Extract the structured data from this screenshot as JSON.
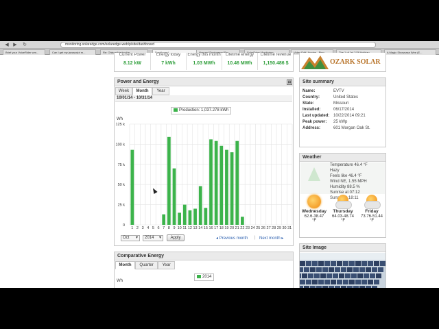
{
  "browser": {
    "url": "monitoring.solaredge.com/solaredge-web/p/site/dashboard",
    "tabs": [
      "Brief your VoiceRider wm...",
      "Can I get my javascript m...",
      "Re: Ohlson/Harbuckie...",
      "Dashboard",
      "Harvard Engineered Pro...",
      "SolarEdge Monitoring",
      "Video Edit Utopian - Bing",
      "The 1 of 1st 2/28 Holiday",
      "A Magic Showcase Wee (E..."
    ]
  },
  "stats": [
    {
      "label": "Current Power",
      "value": "8.12 kW"
    },
    {
      "label": "Energy today",
      "value": "7 kWh"
    },
    {
      "label": "Energy this month",
      "value": "1.03 MWh"
    },
    {
      "label": "Lifetime energy",
      "value": "10.46 MWh"
    },
    {
      "label": "Lifetime revenue",
      "value": "1,150.486 $"
    }
  ],
  "logo_text": "OZARK SOLAR",
  "power_energy": {
    "title": "Power and Energy",
    "tabs": [
      "Week",
      "Month",
      "Year"
    ],
    "selected_tab": "Month",
    "date_range": "10/01/14 - 10/31/14",
    "month_value": "Oct",
    "year_value": "2014",
    "apply_label": "Apply",
    "prev_label": "Previous month",
    "next_label": "Next month",
    "separator": "|",
    "prev_arrow": "◂",
    "next_arrow": "▸"
  },
  "chart_data": {
    "type": "bar",
    "ylabel": "Wh",
    "y_ticks": [
      "0",
      "25 k",
      "50 k",
      "75 k",
      "100 k",
      "125 k"
    ],
    "ylim": [
      0,
      125000
    ],
    "categories": [
      "1",
      "2",
      "3",
      "4",
      "5",
      "6",
      "7",
      "8",
      "9",
      "10",
      "11",
      "12",
      "13",
      "14",
      "15",
      "16",
      "17",
      "18",
      "19",
      "20",
      "21",
      "22",
      "23",
      "24",
      "25",
      "26",
      "27",
      "28",
      "29",
      "30",
      "31"
    ],
    "series": [
      {
        "name": "Production: 1,037.278 kWh",
        "color": "#3cb34b",
        "values": [
          93000,
          0,
          0,
          0,
          0,
          0,
          13000,
          109000,
          70000,
          15000,
          25000,
          18000,
          20000,
          48000,
          21000,
          106000,
          104000,
          98000,
          93000,
          90000,
          104000,
          10000,
          0,
          0,
          0,
          0,
          0,
          0,
          0,
          0,
          0
        ]
      }
    ],
    "grid": true,
    "legend": "top-center"
  },
  "site_summary": {
    "title": "Site summary",
    "rows": [
      {
        "label": "Name:",
        "value": "EVTV"
      },
      {
        "label": "Country:",
        "value": "United States"
      },
      {
        "label": "State:",
        "value": "Missouri"
      },
      {
        "label": "Installed:",
        "value": "06/17/2014"
      },
      {
        "label": "Last updated:",
        "value": "10/22/2014 09:21"
      },
      {
        "label": "Peak power:",
        "value": "25 kWp"
      },
      {
        "label": "Address:",
        "value": "601 Morgan Oak St."
      }
    ]
  },
  "weather": {
    "title": "Weather",
    "lines": [
      "Temperature 46.4 °F",
      "Hazy",
      "Feels like 46.4 °F",
      "Wind NE, 1.55 MPH",
      "Humidity 88.5 %",
      "Sunrise at 07:12",
      "Sunset at 18:11"
    ],
    "forecast": [
      {
        "day": "Wednesday",
        "range": "62.6-38.47",
        "unit": "°F"
      },
      {
        "day": "Thursday",
        "range": "64.03-48.74",
        "unit": "°F"
      },
      {
        "day": "Friday",
        "range": "73.76-51.44",
        "unit": "°F"
      }
    ]
  },
  "comparative": {
    "title": "Comparative Energy",
    "tabs": [
      "Month",
      "Quarter",
      "Year"
    ],
    "selected_tab": "Month",
    "ylabel": "Wh",
    "legend": "2014"
  },
  "site_image": {
    "title": "Site Image"
  }
}
